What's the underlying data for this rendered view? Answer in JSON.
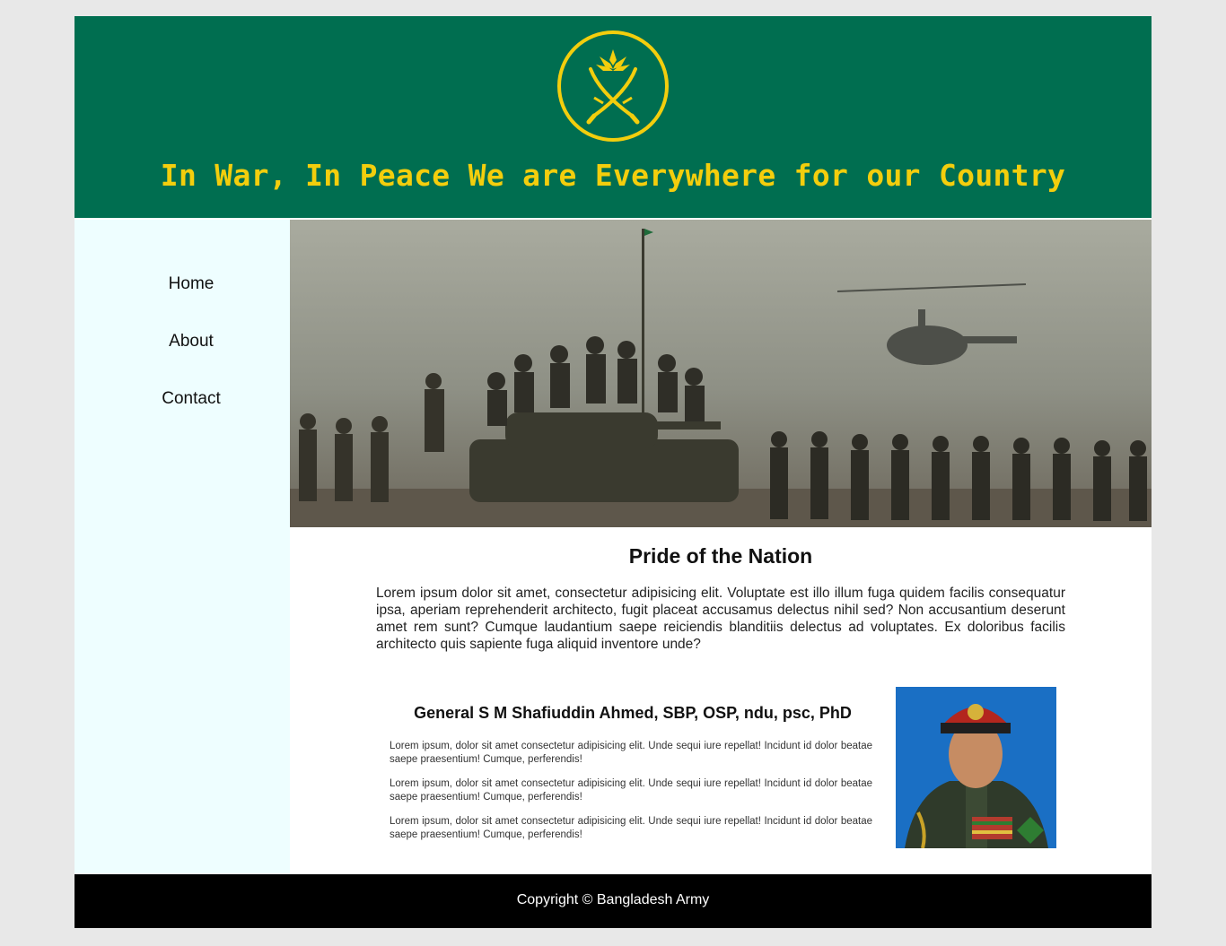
{
  "brand": {
    "tagline": "In War, In Peace We are Everywhere for our Country",
    "primary_color": "#006e50",
    "accent_color": "#f3ce0d",
    "logo_icon": "army-emblem-crossed-swords-icon"
  },
  "nav": {
    "items": [
      {
        "label": "Home"
      },
      {
        "label": "About"
      },
      {
        "label": "Contact"
      }
    ]
  },
  "hero": {
    "image": "soldiers-tank-helicopter-photo"
  },
  "main": {
    "title": "Pride of the Nation",
    "intro": "Lorem ipsum dolor sit amet, consectetur adipisicing elit. Voluptate est illo illum fuga quidem facilis consequatur ipsa, aperiam reprehenderit architecto, fugit placeat accusamus delectus nihil sed? Non accusantium deserunt amet rem sunt? Cumque laudantium saepe reiciendis blanditiis delectus ad voluptates. Ex doloribus facilis architecto quis sapiente fuga aliquid inventore unde?"
  },
  "chief": {
    "name": "General S M Shafiuddin Ahmed, SBP, OSP, ndu, psc, PhD",
    "paragraphs": [
      "Lorem ipsum, dolor sit amet consectetur adipisicing elit. Unde sequi iure repellat! Incidunt id dolor beatae saepe praesentium! Cumque, perferendis!",
      "Lorem ipsum, dolor sit amet consectetur adipisicing elit. Unde sequi iure repellat! Incidunt id dolor beatae saepe praesentium! Cumque, perferendis!",
      "Lorem ipsum, dolor sit amet consectetur adipisicing elit. Unde sequi iure repellat! Incidunt id dolor beatae saepe praesentium! Cumque, perferendis!"
    ]
  },
  "footer": {
    "copyright": "Copyright © Bangladesh Army"
  }
}
